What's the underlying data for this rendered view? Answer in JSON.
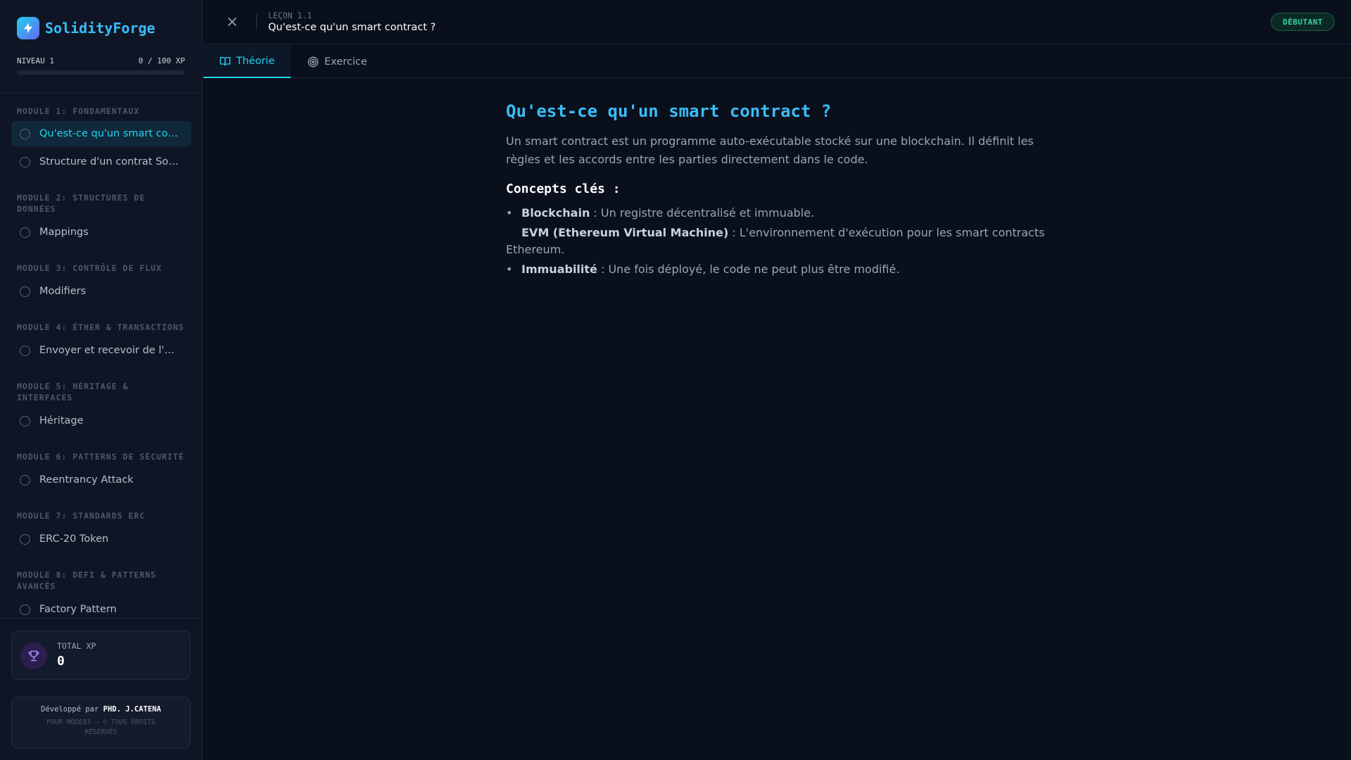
{
  "brand": {
    "name": "SolidityForge"
  },
  "level": {
    "label": "NIVEAU 1",
    "xp": "0 / 100 XP",
    "progress_fraction": 0
  },
  "modules": [
    {
      "title": "MODULE 1: FONDAMENTAUX",
      "lessons": [
        {
          "label": "Qu'est-ce qu'un smart contract ?",
          "active": true
        },
        {
          "label": "Structure d'un contrat Solidity"
        }
      ]
    },
    {
      "title": "MODULE 2: STRUCTURES DE DONNÉES",
      "lessons": [
        {
          "label": "Mappings"
        }
      ]
    },
    {
      "title": "MODULE 3: CONTRÔLE DE FLUX",
      "lessons": [
        {
          "label": "Modifiers"
        }
      ]
    },
    {
      "title": "MODULE 4: ÉTHER & TRANSACTIONS",
      "lessons": [
        {
          "label": "Envoyer et recevoir de l'Ether"
        }
      ]
    },
    {
      "title": "MODULE 5: HÉRITAGE & INTERFACES",
      "lessons": [
        {
          "label": "Héritage"
        }
      ]
    },
    {
      "title": "MODULE 6: PATTERNS DE SÉCURITÉ",
      "lessons": [
        {
          "label": "Reentrancy Attack"
        }
      ]
    },
    {
      "title": "MODULE 7: STANDARDS ERC",
      "lessons": [
        {
          "label": "ERC-20 Token"
        }
      ]
    },
    {
      "title": "MODULE 8: DEFI & PATTERNS AVANCÉS",
      "lessons": [
        {
          "label": "Factory Pattern"
        }
      ]
    }
  ],
  "xp_card": {
    "label": "TOTAL XP",
    "value": "0"
  },
  "credits": {
    "prefix": "Développé par",
    "author": "PHD. J.CATENA",
    "rights": "POUR MODE83 — © TOUS DROITS RÉSERVÉS"
  },
  "header": {
    "lesson_number": "LEÇON 1.1",
    "lesson_title": "Qu'est-ce qu'un smart contract ?",
    "badge": "DÉBUTANT"
  },
  "tabs": [
    {
      "label": "Théorie",
      "active": true
    },
    {
      "label": "Exercice"
    }
  ],
  "content": {
    "title": "Qu'est-ce qu'un smart contract ?",
    "intro": "Un smart contract est un programme auto-exécutable stocké sur une blockchain. Il définit les règles et les accords entre les parties directement dans le code.",
    "concepts_heading": "Concepts clés :",
    "concepts": [
      {
        "term": "Blockchain",
        "desc": " : Un registre décentralisé et immuable."
      },
      {
        "term": "EVM (Ethereum Virtual Machine)",
        "desc": " : L'environnement d'exécution pour les smart contracts Ethereum."
      },
      {
        "term": "Immuabilité",
        "desc": " : Une fois déployé, le code ne peut plus être modifié."
      }
    ]
  },
  "colors": {
    "accent": "#22d3ee",
    "badge_green": "#34d399",
    "background": "#0a0f1c",
    "sidebar": "#0f1524"
  },
  "icons": {
    "logo": "lightning-icon",
    "close": "close-icon",
    "theory_tab": "book-icon",
    "exercise_tab": "target-icon",
    "xp": "trophy-icon",
    "lesson_status": "circle-icon"
  }
}
